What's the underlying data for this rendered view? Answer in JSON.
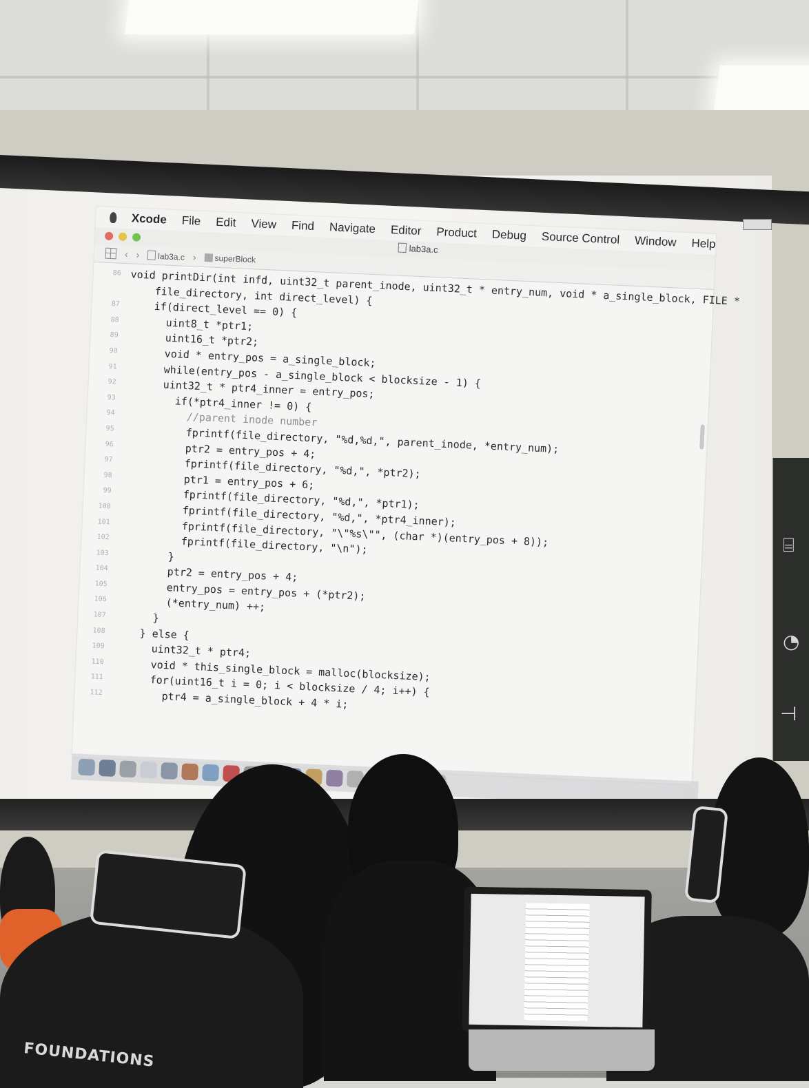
{
  "menubar": {
    "app_name": "Xcode",
    "items": [
      "File",
      "Edit",
      "View",
      "Find",
      "Navigate",
      "Editor",
      "Product",
      "Debug",
      "Source Control",
      "Window",
      "Help"
    ]
  },
  "window": {
    "title_file": "lab3a.c"
  },
  "jumpbar": {
    "crumb_file": "lab3a.c",
    "crumb_symbol": "superBlock"
  },
  "code": [
    {
      "ln": "86",
      "text": "void printDir(int infd, uint32_t parent_inode, uint32_t * entry_num, void * a_single_block, FILE *",
      "kind": "code"
    },
    {
      "ln": "",
      "text": "    file_directory, int direct_level) {",
      "kind": "code"
    },
    {
      "ln": "87",
      "text": "    if(direct_level == 0) {",
      "kind": "code"
    },
    {
      "ln": "88",
      "text": "      uint8_t *ptr1;",
      "kind": "code"
    },
    {
      "ln": "89",
      "text": "      uint16_t *ptr2;",
      "kind": "code"
    },
    {
      "ln": "90",
      "text": "      void * entry_pos = a_single_block;",
      "kind": "code"
    },
    {
      "ln": "91",
      "text": "      while(entry_pos - a_single_block < blocksize - 1) {",
      "kind": "code"
    },
    {
      "ln": "92",
      "text": "      uint32_t * ptr4_inner = entry_pos;",
      "kind": "code"
    },
    {
      "ln": "93",
      "text": "        if(*ptr4_inner != 0) {",
      "kind": "code"
    },
    {
      "ln": "94",
      "text": "          //parent inode number",
      "kind": "comment"
    },
    {
      "ln": "95",
      "text": "          fprintf(file_directory, \"%d,%d,\", parent_inode, *entry_num);",
      "kind": "code"
    },
    {
      "ln": "96",
      "text": "          ptr2 = entry_pos + 4;",
      "kind": "code"
    },
    {
      "ln": "97",
      "text": "          fprintf(file_directory, \"%d,\", *ptr2);",
      "kind": "code"
    },
    {
      "ln": "98",
      "text": "          ptr1 = entry_pos + 6;",
      "kind": "code"
    },
    {
      "ln": "99",
      "text": "          fprintf(file_directory, \"%d,\", *ptr1);",
      "kind": "code"
    },
    {
      "ln": "100",
      "text": "          fprintf(file_directory, \"%d,\", *ptr4_inner);",
      "kind": "code"
    },
    {
      "ln": "101",
      "text": "          fprintf(file_directory, \"\\\"%s\\\"\", (char *)(entry_pos + 8));",
      "kind": "code"
    },
    {
      "ln": "102",
      "text": "          fprintf(file_directory, \"\\n\");",
      "kind": "code"
    },
    {
      "ln": "103",
      "text": "        }",
      "kind": "code"
    },
    {
      "ln": "104",
      "text": "        ptr2 = entry_pos + 4;",
      "kind": "code"
    },
    {
      "ln": "105",
      "text": "        entry_pos = entry_pos + (*ptr2);",
      "kind": "code"
    },
    {
      "ln": "106",
      "text": "        (*entry_num) ++;",
      "kind": "code"
    },
    {
      "ln": "107",
      "text": "      }",
      "kind": "code"
    },
    {
      "ln": "108",
      "text": "    } else {",
      "kind": "code"
    },
    {
      "ln": "109",
      "text": "      uint32_t * ptr4;",
      "kind": "code"
    },
    {
      "ln": "110",
      "text": "      void * this_single_block = malloc(blocksize);",
      "kind": "code"
    },
    {
      "ln": "111",
      "text": "      for(uint16_t i = 0; i < blocksize / 4; i++) {",
      "kind": "code"
    },
    {
      "ln": "112",
      "text": "        ptr4 = a_single_block + 4 * i;",
      "kind": "code"
    }
  ],
  "foreground": {
    "hat_text": "FOUNDATIONS"
  },
  "colors": {
    "screen": "#f4f3f0",
    "code_text": "#2b2b2b",
    "comment": "#8e8e8e",
    "line_numbers": "#b0b0b0"
  }
}
